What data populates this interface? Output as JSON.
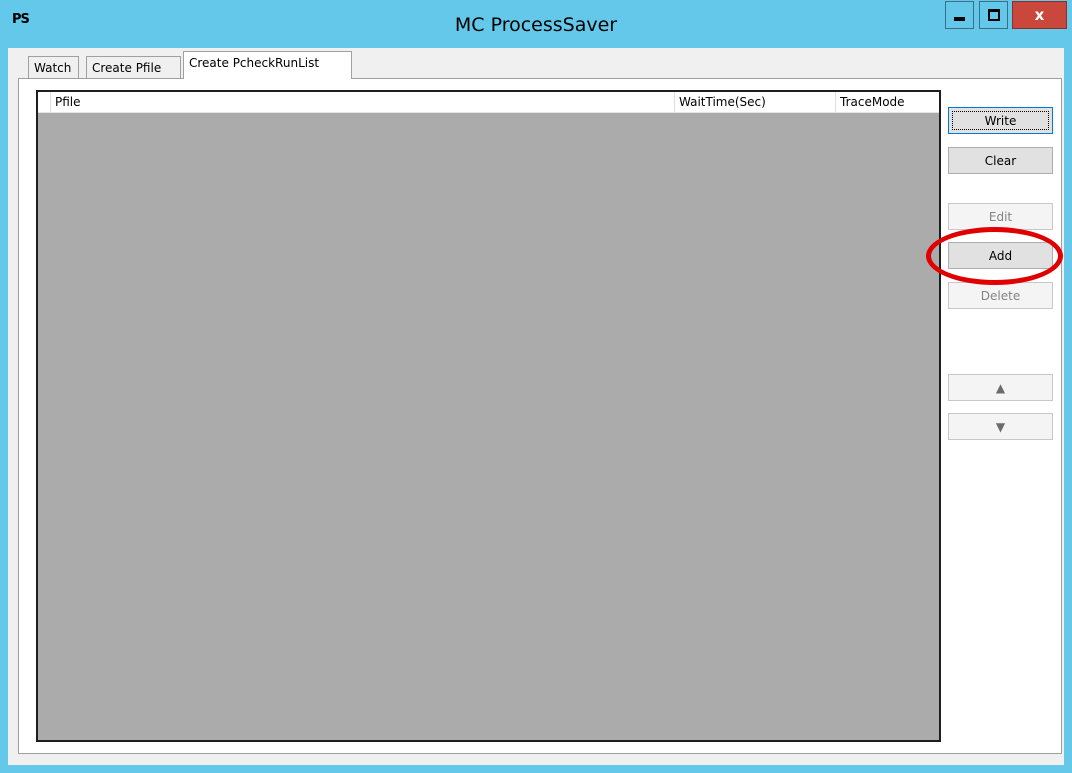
{
  "window": {
    "app_icon_text": "PS",
    "title": "MC ProcessSaver",
    "controls": {
      "minimize": "minimize-icon",
      "maximize": "maximize-icon",
      "close": "close-icon",
      "close_glyph": "x"
    }
  },
  "tabs": [
    {
      "label": "Watch",
      "selected": false
    },
    {
      "label": "Create Pfile",
      "selected": false
    },
    {
      "label": "Create PcheckRunList",
      "selected": true
    }
  ],
  "listview": {
    "columns": [
      "Pfile",
      "WaitTime(Sec)",
      "TraceMode"
    ],
    "rows": []
  },
  "buttons": {
    "write": {
      "label": "Write",
      "enabled": true
    },
    "clear": {
      "label": "Clear",
      "enabled": true
    },
    "edit": {
      "label": "Edit",
      "enabled": false
    },
    "add": {
      "label": "Add",
      "enabled": true
    },
    "delete": {
      "label": "Delete",
      "enabled": false
    },
    "move_up": {
      "label": "▲",
      "icon": "arrow-up-icon",
      "enabled": false
    },
    "move_down": {
      "label": "▼",
      "icon": "arrow-down-icon",
      "enabled": false
    }
  },
  "annotation": {
    "highlight_color": "#e00000",
    "target": "add"
  },
  "colors": {
    "titlebar": "#63c8ea",
    "close_button": "#c9483b",
    "list_background": "#ababab"
  }
}
